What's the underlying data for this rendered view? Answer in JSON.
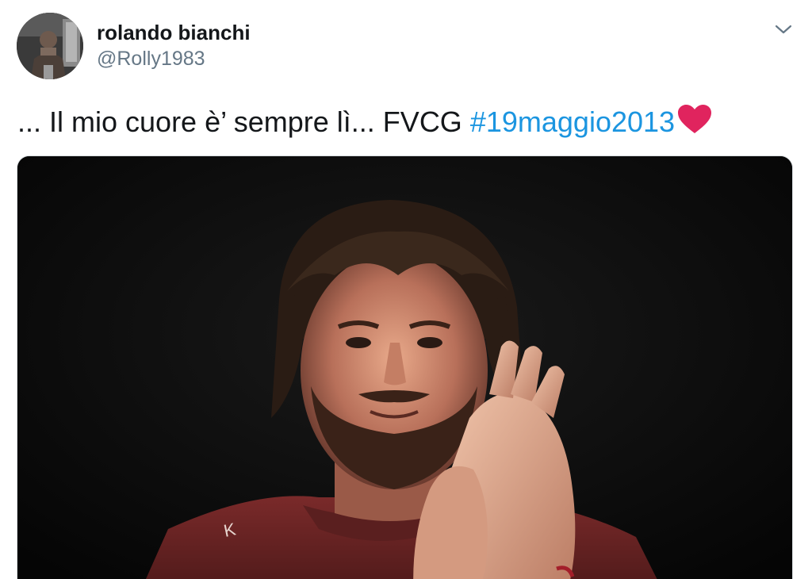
{
  "tweet": {
    "author": {
      "display_name": "rolando bianchi",
      "handle": "@Rolly1983"
    },
    "text_plain": "... Il mio cuore è’ sempre lì... FVCG ",
    "hashtag": "#19maggio2013",
    "emoji": "heart-icon",
    "media": {
      "icon": "photo"
    }
  },
  "colors": {
    "hashtag": "#1b95e0",
    "heart": "#e0245e",
    "handle": "#657786",
    "text": "#14171a"
  }
}
